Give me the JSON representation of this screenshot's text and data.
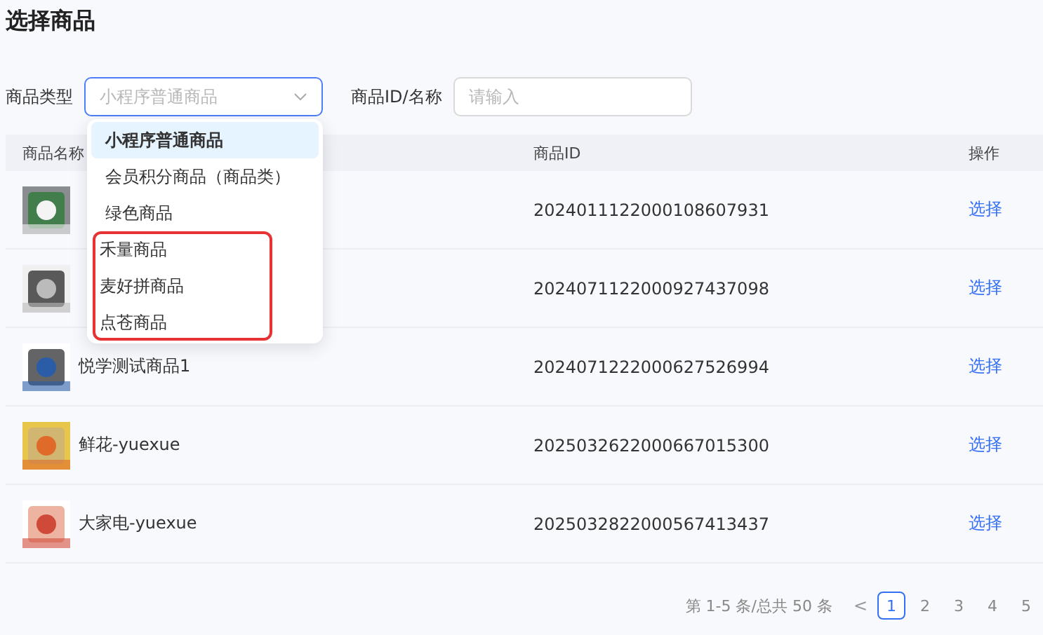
{
  "title": "选择商品",
  "filters": {
    "type_label": "商品类型",
    "type_value": "小程序普通商品",
    "type_open": true,
    "id_label": "商品ID/名称",
    "id_placeholder": "请输入"
  },
  "dropdown": [
    {
      "label": "小程序普通商品",
      "selected": true,
      "highlighted": false
    },
    {
      "label": "会员积分商品（商品类）",
      "selected": false,
      "highlighted": false
    },
    {
      "label": "绿色商品",
      "selected": false,
      "highlighted": false
    },
    {
      "label": "禾量商品",
      "selected": false,
      "highlighted": true
    },
    {
      "label": "麦好拼商品",
      "selected": false,
      "highlighted": true
    },
    {
      "label": "点苍商品",
      "selected": false,
      "highlighted": true
    }
  ],
  "table": {
    "columns": [
      "商品名称",
      "商品ID",
      "操作"
    ],
    "rows": [
      {
        "kind": "picture",
        "name": "",
        "id": "2024011122000108607931",
        "action": "选择"
      },
      {
        "kind": "picture",
        "name": "",
        "id": "2024071122000927437098",
        "action": "选择"
      },
      {
        "kind": "picture",
        "name": "悦学测试商品1",
        "id": "2024071222000627526994",
        "action": "选择"
      },
      {
        "kind": "picture",
        "name": "鲜花-yuexue",
        "id": "2025032622000667015300",
        "action": "选择"
      },
      {
        "kind": "picture",
        "name": "大家电-yuexue",
        "id": "2025032822000567413437",
        "action": "选择"
      }
    ]
  },
  "pagination": {
    "summary": "第 1-5 条/总共 50 条",
    "prev": "<",
    "pages": [
      {
        "label": "1",
        "selected": true
      },
      {
        "label": "2",
        "selected": false
      },
      {
        "label": "3",
        "selected": false
      },
      {
        "label": "4",
        "selected": false
      },
      {
        "label": "5",
        "selected": false
      }
    ]
  }
}
